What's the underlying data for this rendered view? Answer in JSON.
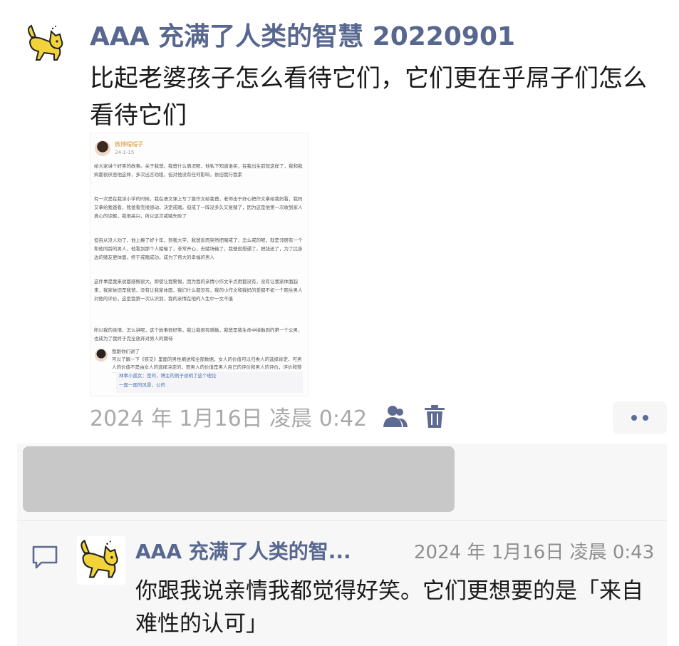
{
  "post": {
    "author": "AAA 充满了人类的智慧 20220901",
    "body": "比起老婆孩子怎么看待它们，它们更在乎屌子们怎么看待它们",
    "timestamp": "2024 年 1月16日 凌晨 0:42",
    "avatar_icon": "cat-icon"
  },
  "embedded_screenshot": {
    "name": "微博帽帽子",
    "date": "24-1-15",
    "paragraphs": [
      "给大家讲个好笑的故事。关于我爸。我爸什么情况呢，他私下知道谁买，在我出生前就这样了，我和我妈都很厌恶他这样，多次出言劝阻，但对他没有任何影响，依旧我行我素",
      "有一次是在我读小学的时候，我在语文课上写了篇作文给我爸，老师出于好心把作文拿给我妈看，我妈又拿给我爸看，我爸看完很感动，决定戒赌。但戒了一阵没多久又复赌了，因为这是他第一次收到家人真心的谅解，我很高兴，所以这次戒赌失败了",
      "但自从没人劝了，他上瘾了好十年，到我大学，我爸反而突然把赌戒了，怎么戒的呢，就是邻居有一个和他同龄的男人，他看到那个人赌输了，非常开心，去赌场输了，我爸就想通了，把钱还了，为了比身边的赌友更体面，终于戒赌成功，成为了伟大的幸福的男人",
      "这件事是我来说都感慨很大，即使让我警惕，因为我的亲情小作文半点用都没有，没有让我家体面起来，我家依旧是我爸，没有让我家体面，我们什么都没有，我的小作文和我妈的爱都不如一个陌生男人对他的评价，这是我第一次认识到，我的亲情在他的人生中一文不值",
      "所以我的亲情，怎么讲呢，这个故事很好笑，我让我很有感触，我爸是我生命中接触到的第一个公男，也成为了我终于完全放弃对男人的期待"
    ],
    "reply_name": "我跟你们讲了",
    "reply_text": "可以了解一下《铁交》里面的男性阐述和全部数据，女人的价值可以归类人的选择肯定，可男人的价值不是由女人的选择决定的，而男人的价值是男人自己的评价和男人的评价，评价和赞誉",
    "quote_lines": [
      "林事小孤女：是的，博主的例子说明了这个理论",
      "一面一面的风景，公的"
    ]
  },
  "actions": {
    "author_icon": "user-group-icon",
    "delete_icon": "trash-icon",
    "more_icon": "more-dots-icon"
  },
  "comment": {
    "icon": "comment-icon",
    "author": "AAA 充满了人类的智...",
    "timestamp": "2024 年 1月16日 凌晨 0:43",
    "text": "你跟我说亲情我都觉得好笑。它们更想要的是「来自难性的认可」"
  },
  "colors": {
    "author_blue": "#58678f",
    "timestamp_gray": "#a9a9a9",
    "cat_yellow": "#f2d43a"
  }
}
